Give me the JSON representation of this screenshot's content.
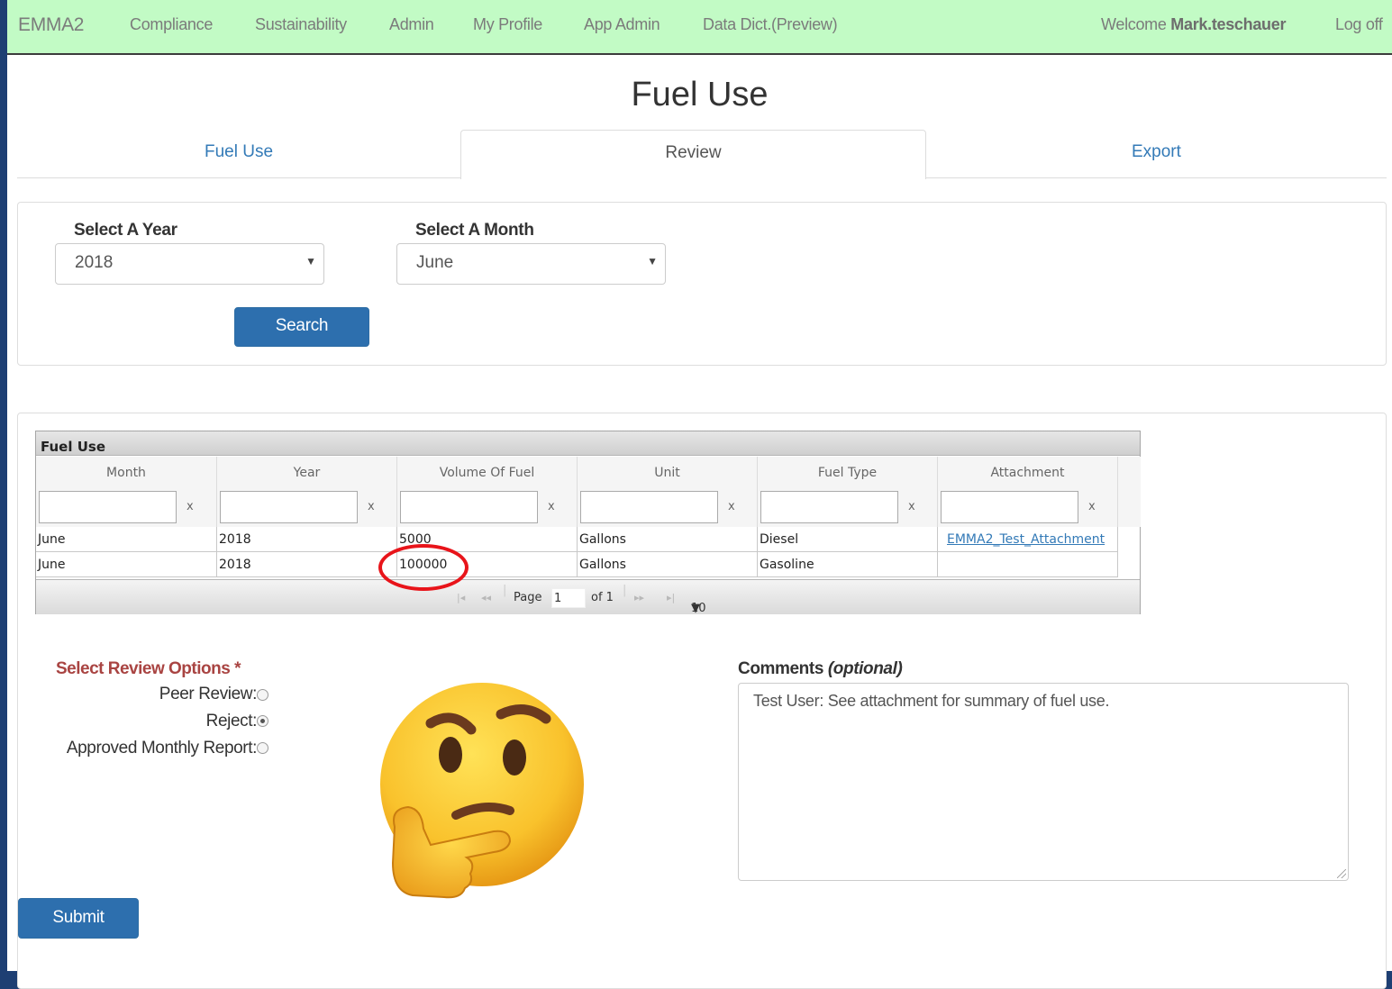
{
  "nav": {
    "brand": "EMMA2",
    "items": [
      "Compliance",
      "Sustainability",
      "Admin",
      "My Profile",
      "App Admin",
      "Data Dict.(Preview)"
    ],
    "welcome_prefix": "Welcome",
    "username": "Mark.teschauer",
    "logoff": "Log off"
  },
  "page_title": "Fuel Use",
  "tabs": [
    {
      "label": "Fuel Use",
      "active": false
    },
    {
      "label": "Review",
      "active": true
    },
    {
      "label": "Export",
      "active": false
    }
  ],
  "filters": {
    "year_label": "Select A Year",
    "year_value": "2018",
    "month_label": "Select A Month",
    "month_value": "June",
    "search_label": "Search"
  },
  "grid": {
    "caption": "Fuel Use",
    "columns": [
      "Month",
      "Year",
      "Volume Of Fuel",
      "Unit",
      "Fuel Type",
      "Attachment"
    ],
    "filter_clear": "x",
    "rows": [
      [
        "June",
        "2018",
        "5000",
        "Gallons",
        "Diesel",
        "EMMA2_Test_Attachment"
      ],
      [
        "June",
        "2018",
        "100000",
        "Gallons",
        "Gasoline",
        ""
      ]
    ],
    "pager": {
      "page_label": "Page",
      "page_value": "1",
      "of_label": "of 1",
      "page_size": "10"
    },
    "highlight_color": "#e8141a"
  },
  "review": {
    "title": "Select Review Options",
    "required_mark": "*",
    "options": [
      {
        "label": "Peer Review:",
        "selected": false
      },
      {
        "label": "Reject:",
        "selected": true
      },
      {
        "label": "Approved Monthly Report:",
        "selected": false
      }
    ]
  },
  "comments": {
    "label": "Comments",
    "label_suffix": "(optional)",
    "value": "Test User: See attachment for summary of fuel use."
  },
  "submit_label": "Submit",
  "colors": {
    "nav_bg": "#c2fbc5",
    "primary": "#2d6fae",
    "link": "#337ab7",
    "required": "#a94442",
    "frame": "#1e3f73"
  },
  "emoji": "thinking-face"
}
